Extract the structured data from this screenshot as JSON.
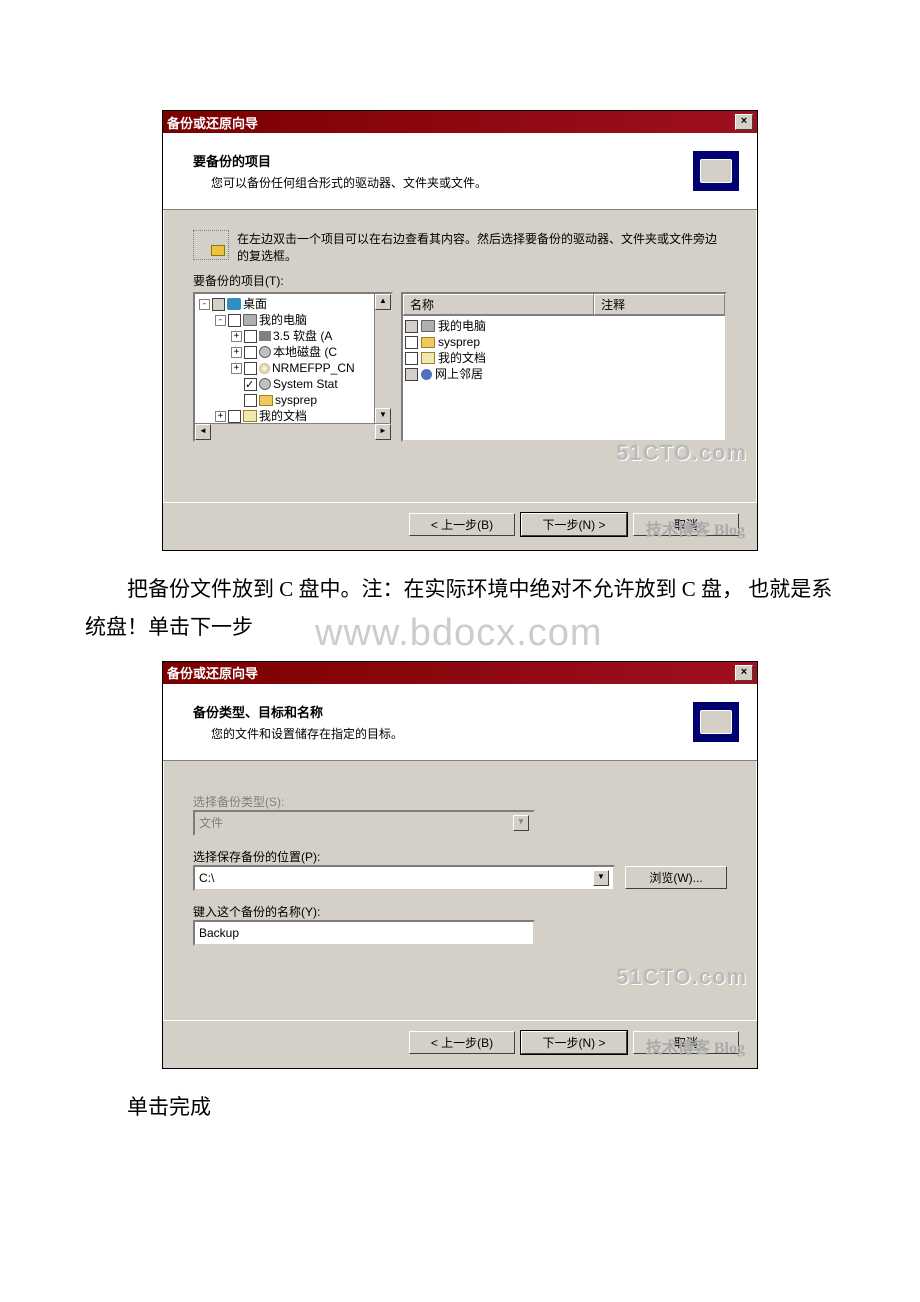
{
  "dialog1": {
    "title": "备份或还原向导",
    "header_title": "要备份的项目",
    "header_sub": "您可以备份任何组合形式的驱动器、文件夹或文件。",
    "instruction": "在左边双击一个项目可以在右边查看其内容。然后选择要备份的驱动器、文件夹或文件旁边的复选框。",
    "label_items": "要备份的项目(T):",
    "tree": [
      {
        "indent": 0,
        "expander": "-",
        "checkbox": "gray",
        "icon": "desktop",
        "text": "桌面"
      },
      {
        "indent": 1,
        "expander": "-",
        "checkbox": "off",
        "icon": "computer",
        "text": "我的电脑"
      },
      {
        "indent": 2,
        "expander": "+",
        "checkbox": "off",
        "icon": "floppy",
        "text": "3.5 软盘  (A"
      },
      {
        "indent": 2,
        "expander": "+",
        "checkbox": "off",
        "icon": "disk",
        "text": "本地磁盘  (C"
      },
      {
        "indent": 2,
        "expander": "+",
        "checkbox": "off",
        "icon": "cd",
        "text": "NRMEFPP_CN"
      },
      {
        "indent": 2,
        "expander": "",
        "checkbox": "on",
        "icon": "disk",
        "text": "System Stat"
      },
      {
        "indent": 2,
        "expander": "",
        "checkbox": "off",
        "icon": "folder",
        "text": "sysprep"
      },
      {
        "indent": 1,
        "expander": "+",
        "checkbox": "off",
        "icon": "docfolder",
        "text": "我的文档"
      }
    ],
    "list_cols": {
      "name": "名称",
      "comment": "注释"
    },
    "list_rows": [
      {
        "checkbox": "gray",
        "icon": "computer",
        "text": "我的电脑"
      },
      {
        "checkbox": "off",
        "icon": "folder",
        "text": "sysprep"
      },
      {
        "checkbox": "off",
        "icon": "docfolder",
        "text": "我的文档"
      },
      {
        "checkbox": "gray",
        "icon": "net",
        "text": "网上邻居"
      }
    ],
    "btn_back": "< 上一步(B)",
    "btn_next": "下一步(N) >",
    "btn_cancel": "取消",
    "watermark_top": "51CTO.com",
    "watermark_bottom": "技术博客 Blog"
  },
  "para1_a": "把备份文件放到 C 盘中。注：在实际环境中绝对不允许放到 C 盘， 也就是系统盘！单击下一步",
  "big_wm": "www.bdocx.com",
  "dialog2": {
    "title": "备份或还原向导",
    "header_title": "备份类型、目标和名称",
    "header_sub": "您的文件和设置储存在指定的目标。",
    "label_type": "选择备份类型(S):",
    "value_type": "文件",
    "label_loc": "选择保存备份的位置(P):",
    "value_loc": "C:\\",
    "btn_browse": "浏览(W)...",
    "label_name": "键入这个备份的名称(Y):",
    "value_name": "Backup",
    "btn_back": "< 上一步(B)",
    "btn_next": "下一步(N) >",
    "btn_cancel": "取消",
    "watermark_top": "51CTO.com",
    "watermark_bottom": "技术博客 Blog"
  },
  "para2": "单击完成"
}
